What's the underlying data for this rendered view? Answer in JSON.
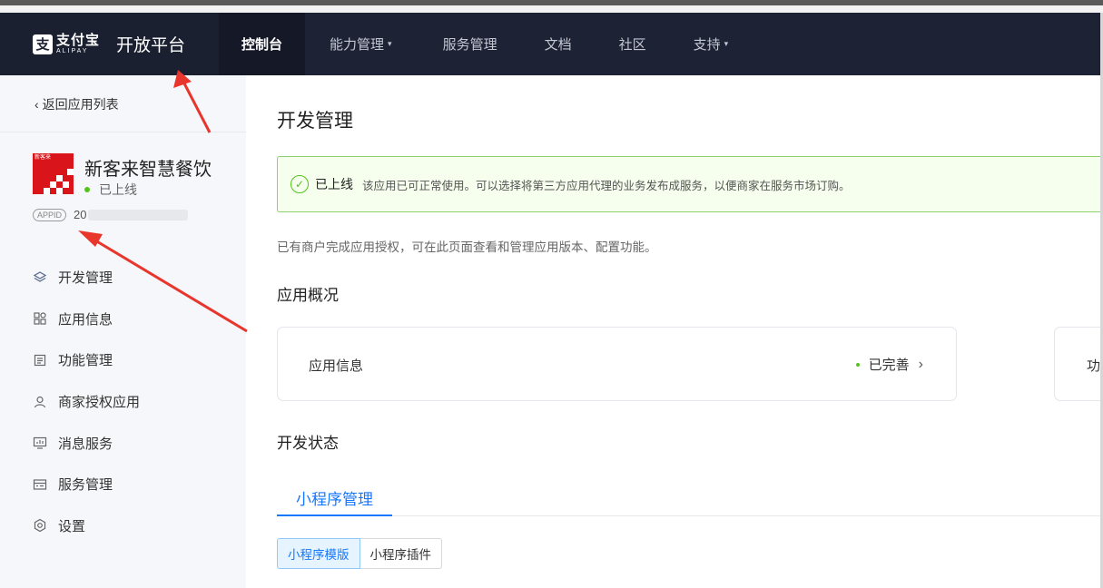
{
  "header": {
    "logo_cn": "支付宝",
    "logo_en": "ALIPAY",
    "logo_glyph": "支",
    "platform": "开放平台",
    "nav": [
      {
        "label": "控制台",
        "caret": ""
      },
      {
        "label": "能力管理",
        "caret": "▾"
      },
      {
        "label": "服务管理",
        "caret": ""
      },
      {
        "label": "文档",
        "caret": ""
      },
      {
        "label": "社区",
        "caret": ""
      },
      {
        "label": "支持",
        "caret": "▾"
      }
    ]
  },
  "sidebar": {
    "back_label": "返回应用列表",
    "app": {
      "name": "新客来智慧餐饮",
      "status": "已上线",
      "logo_text": "新客来",
      "appid_badge": "APPID",
      "appid_prefix": "20"
    },
    "menu": [
      {
        "label": "开发管理",
        "icon": "layers-icon"
      },
      {
        "label": "应用信息",
        "icon": "apps-grid-icon"
      },
      {
        "label": "功能管理",
        "icon": "document-icon"
      },
      {
        "label": "商家授权应用",
        "icon": "user-icon"
      },
      {
        "label": "消息服务",
        "icon": "monitor-chart-icon"
      },
      {
        "label": "服务管理",
        "icon": "panel-icon"
      },
      {
        "label": "设置",
        "icon": "gear-icon"
      }
    ]
  },
  "main": {
    "title": "开发管理",
    "alert": {
      "title": "已上线",
      "text": "该应用已可正常使用。可以选择将第三方应用代理的业务发布成服务，以便商家在服务市场订购。"
    },
    "description": "已有商户完成应用授权，可在此页面查看和管理应用版本、配置功能。",
    "overview_title": "应用概况",
    "cards": [
      {
        "label": "应用信息",
        "status": "已完善"
      },
      {
        "label": "功"
      }
    ],
    "dev_status_title": "开发状态",
    "tab": "小程序管理",
    "segments": [
      "小程序模版",
      "小程序插件"
    ]
  },
  "colors": {
    "nav_bg": "#1e2235",
    "accent": "#1677ff",
    "success": "#52c41a",
    "annotation_arrow": "#e8362c"
  }
}
